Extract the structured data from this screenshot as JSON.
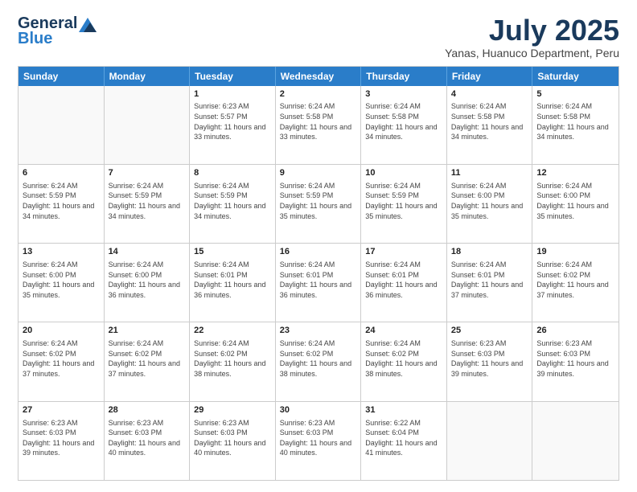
{
  "header": {
    "logo_general": "General",
    "logo_blue": "Blue",
    "title": "July 2025",
    "location": "Yanas, Huanuco Department, Peru"
  },
  "weekdays": [
    "Sunday",
    "Monday",
    "Tuesday",
    "Wednesday",
    "Thursday",
    "Friday",
    "Saturday"
  ],
  "weeks": [
    [
      {
        "day": "",
        "info": ""
      },
      {
        "day": "",
        "info": ""
      },
      {
        "day": "1",
        "info": "Sunrise: 6:23 AM\nSunset: 5:57 PM\nDaylight: 11 hours and 33 minutes."
      },
      {
        "day": "2",
        "info": "Sunrise: 6:24 AM\nSunset: 5:58 PM\nDaylight: 11 hours and 33 minutes."
      },
      {
        "day": "3",
        "info": "Sunrise: 6:24 AM\nSunset: 5:58 PM\nDaylight: 11 hours and 34 minutes."
      },
      {
        "day": "4",
        "info": "Sunrise: 6:24 AM\nSunset: 5:58 PM\nDaylight: 11 hours and 34 minutes."
      },
      {
        "day": "5",
        "info": "Sunrise: 6:24 AM\nSunset: 5:58 PM\nDaylight: 11 hours and 34 minutes."
      }
    ],
    [
      {
        "day": "6",
        "info": "Sunrise: 6:24 AM\nSunset: 5:59 PM\nDaylight: 11 hours and 34 minutes."
      },
      {
        "day": "7",
        "info": "Sunrise: 6:24 AM\nSunset: 5:59 PM\nDaylight: 11 hours and 34 minutes."
      },
      {
        "day": "8",
        "info": "Sunrise: 6:24 AM\nSunset: 5:59 PM\nDaylight: 11 hours and 34 minutes."
      },
      {
        "day": "9",
        "info": "Sunrise: 6:24 AM\nSunset: 5:59 PM\nDaylight: 11 hours and 35 minutes."
      },
      {
        "day": "10",
        "info": "Sunrise: 6:24 AM\nSunset: 5:59 PM\nDaylight: 11 hours and 35 minutes."
      },
      {
        "day": "11",
        "info": "Sunrise: 6:24 AM\nSunset: 6:00 PM\nDaylight: 11 hours and 35 minutes."
      },
      {
        "day": "12",
        "info": "Sunrise: 6:24 AM\nSunset: 6:00 PM\nDaylight: 11 hours and 35 minutes."
      }
    ],
    [
      {
        "day": "13",
        "info": "Sunrise: 6:24 AM\nSunset: 6:00 PM\nDaylight: 11 hours and 35 minutes."
      },
      {
        "day": "14",
        "info": "Sunrise: 6:24 AM\nSunset: 6:00 PM\nDaylight: 11 hours and 36 minutes."
      },
      {
        "day": "15",
        "info": "Sunrise: 6:24 AM\nSunset: 6:01 PM\nDaylight: 11 hours and 36 minutes."
      },
      {
        "day": "16",
        "info": "Sunrise: 6:24 AM\nSunset: 6:01 PM\nDaylight: 11 hours and 36 minutes."
      },
      {
        "day": "17",
        "info": "Sunrise: 6:24 AM\nSunset: 6:01 PM\nDaylight: 11 hours and 36 minutes."
      },
      {
        "day": "18",
        "info": "Sunrise: 6:24 AM\nSunset: 6:01 PM\nDaylight: 11 hours and 37 minutes."
      },
      {
        "day": "19",
        "info": "Sunrise: 6:24 AM\nSunset: 6:02 PM\nDaylight: 11 hours and 37 minutes."
      }
    ],
    [
      {
        "day": "20",
        "info": "Sunrise: 6:24 AM\nSunset: 6:02 PM\nDaylight: 11 hours and 37 minutes."
      },
      {
        "day": "21",
        "info": "Sunrise: 6:24 AM\nSunset: 6:02 PM\nDaylight: 11 hours and 37 minutes."
      },
      {
        "day": "22",
        "info": "Sunrise: 6:24 AM\nSunset: 6:02 PM\nDaylight: 11 hours and 38 minutes."
      },
      {
        "day": "23",
        "info": "Sunrise: 6:24 AM\nSunset: 6:02 PM\nDaylight: 11 hours and 38 minutes."
      },
      {
        "day": "24",
        "info": "Sunrise: 6:24 AM\nSunset: 6:02 PM\nDaylight: 11 hours and 38 minutes."
      },
      {
        "day": "25",
        "info": "Sunrise: 6:23 AM\nSunset: 6:03 PM\nDaylight: 11 hours and 39 minutes."
      },
      {
        "day": "26",
        "info": "Sunrise: 6:23 AM\nSunset: 6:03 PM\nDaylight: 11 hours and 39 minutes."
      }
    ],
    [
      {
        "day": "27",
        "info": "Sunrise: 6:23 AM\nSunset: 6:03 PM\nDaylight: 11 hours and 39 minutes."
      },
      {
        "day": "28",
        "info": "Sunrise: 6:23 AM\nSunset: 6:03 PM\nDaylight: 11 hours and 40 minutes."
      },
      {
        "day": "29",
        "info": "Sunrise: 6:23 AM\nSunset: 6:03 PM\nDaylight: 11 hours and 40 minutes."
      },
      {
        "day": "30",
        "info": "Sunrise: 6:23 AM\nSunset: 6:03 PM\nDaylight: 11 hours and 40 minutes."
      },
      {
        "day": "31",
        "info": "Sunrise: 6:22 AM\nSunset: 6:04 PM\nDaylight: 11 hours and 41 minutes."
      },
      {
        "day": "",
        "info": ""
      },
      {
        "day": "",
        "info": ""
      }
    ]
  ]
}
